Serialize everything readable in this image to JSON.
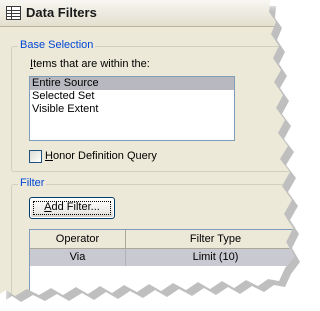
{
  "window": {
    "title": "Data Filters"
  },
  "base_selection": {
    "group_label": "Base Selection",
    "items_label_underlined": "I",
    "items_label_rest": "tems that are within the:",
    "options": [
      "Entire Source",
      "Selected Set",
      "Visible Extent"
    ],
    "selected_index": 0,
    "honor_checkbox_underlined": "H",
    "honor_checkbox_rest": "onor Definition Query",
    "honor_checked": false
  },
  "filter": {
    "group_label": "Filter",
    "add_button_underlined": "A",
    "add_button_rest": "dd Filter...",
    "columns": [
      "Operator",
      "Filter Type"
    ],
    "rows": [
      {
        "operator": "Via",
        "filter_type": "Limit (10)"
      }
    ]
  },
  "icons": {
    "title_icon": "data-table-icon"
  }
}
